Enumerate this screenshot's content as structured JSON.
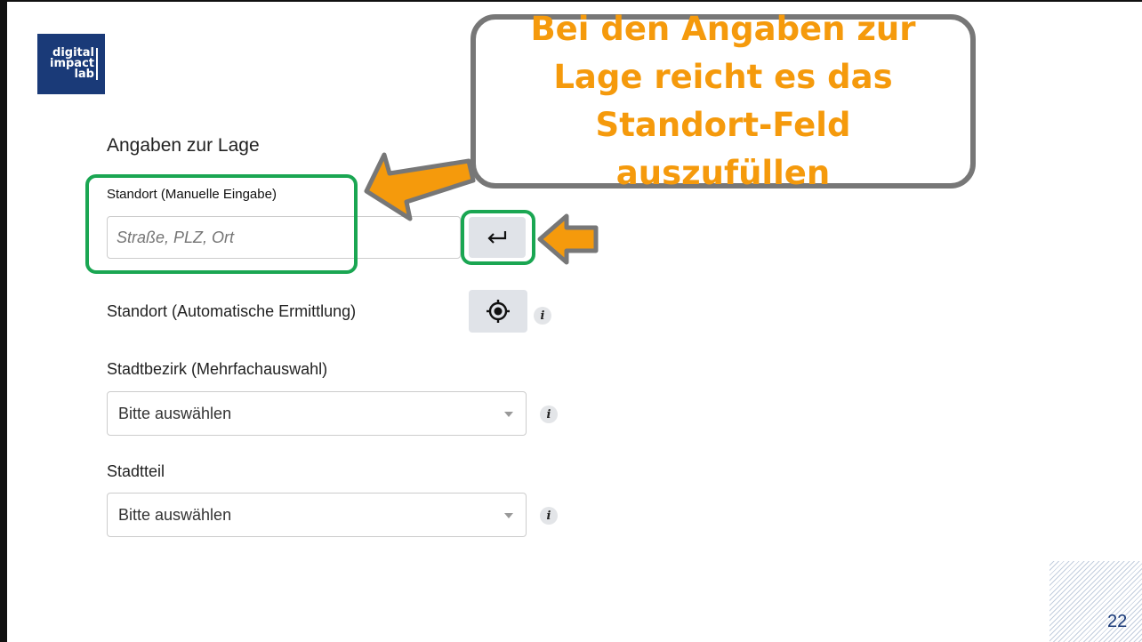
{
  "logo": {
    "line1": "digital",
    "line2": "impact",
    "line3": "lab"
  },
  "callout": {
    "text": "Bei den Angaben zur Lage reicht es das Standort-Feld auszufüllen"
  },
  "form": {
    "section_title": "Angaben zur Lage",
    "manual_label": "Standort (Manuelle Eingabe)",
    "manual_placeholder": "Straße, PLZ, Ort",
    "auto_label": "Standort (Automatische Ermittlung)",
    "district_label": "Stadtbezirk (Mehrfachauswahl)",
    "district_value": "Bitte auswählen",
    "quarter_label": "Stadtteil",
    "quarter_value": "Bitte auswählen",
    "info_glyph": "i"
  },
  "icons": {
    "enter": "enter-arrow-icon",
    "locate": "crosshair-location-icon",
    "info": "info-icon",
    "caret": "chevron-down-icon"
  },
  "colors": {
    "highlight_green": "#1aa652",
    "arrow_orange": "#f59a0c",
    "logo_blue": "#1a3a78"
  },
  "slide": {
    "number": "22"
  }
}
